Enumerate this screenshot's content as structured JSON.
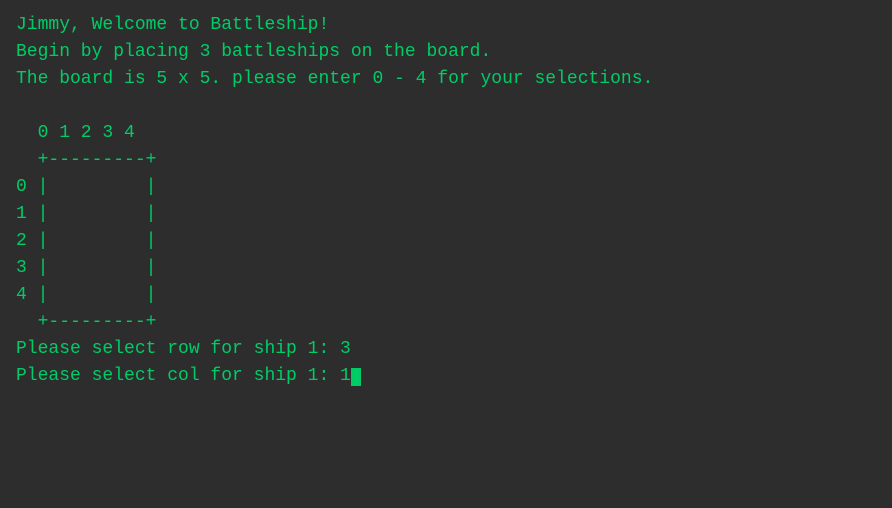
{
  "terminal": {
    "lines": [
      "Jimmy, Welcome to Battleship!",
      "Begin by placing 3 battleships on the board.",
      "The board is 5 x 5. please enter 0 - 4 for your selections.",
      "",
      "  0 1 2 3 4",
      "  +---------+",
      "0 |         |",
      "1 |         |",
      "2 |         |",
      "3 |         |",
      "4 |         |",
      "  +---------+",
      "Please select row for ship 1: 3",
      "Please select col for ship 1: 1"
    ],
    "cursor_visible": true
  }
}
